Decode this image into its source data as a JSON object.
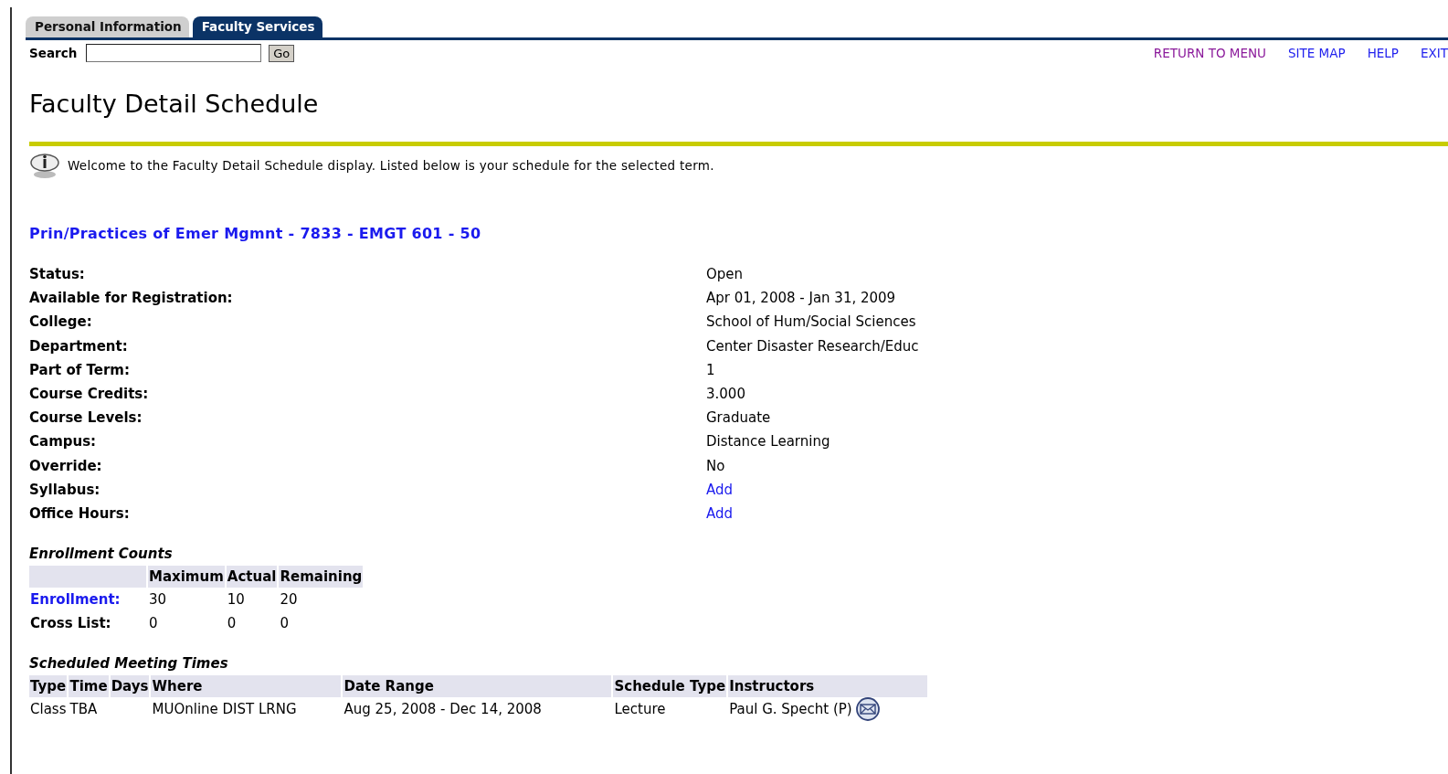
{
  "tabs": [
    {
      "label": "Personal Information",
      "selected": false
    },
    {
      "label": "Faculty Services",
      "selected": true
    }
  ],
  "search": {
    "label": "Search",
    "button": "Go"
  },
  "nav_links": [
    {
      "label": "RETURN TO MENU",
      "visited": true
    },
    {
      "label": "SITE MAP",
      "visited": false
    },
    {
      "label": "HELP",
      "visited": false
    },
    {
      "label": "EXIT",
      "visited": false
    }
  ],
  "page_title": "Faculty Detail Schedule",
  "info_message": "Welcome to the Faculty Detail Schedule display. Listed below is your schedule for the selected term.",
  "course_title": "Prin/Practices of Emer Mgmnt - 7833 - EMGT 601 - 50",
  "details": [
    {
      "label": "Status:",
      "value": "Open",
      "kind": "text"
    },
    {
      "label": "Available for Registration:",
      "value": "Apr 01, 2008 - Jan 31, 2009",
      "kind": "text"
    },
    {
      "label": "College:",
      "value": "School of Hum/Social Sciences",
      "kind": "text"
    },
    {
      "label": "Department:",
      "value": "Center Disaster Research/Educ",
      "kind": "text"
    },
    {
      "label": "Part of Term:",
      "value": "1",
      "kind": "text"
    },
    {
      "label": "Course Credits:",
      "value": "3.000",
      "kind": "text"
    },
    {
      "label": "Course Levels:",
      "value": "Graduate",
      "kind": "text"
    },
    {
      "label": "Campus:",
      "value": "Distance Learning",
      "kind": "text"
    },
    {
      "label": "Override:",
      "value": "No",
      "kind": "text"
    },
    {
      "label": "Syllabus:",
      "value": "Add",
      "kind": "link"
    },
    {
      "label": "Office Hours:",
      "value": "Add",
      "kind": "link"
    }
  ],
  "enrollment": {
    "title": "Enrollment Counts",
    "columns": [
      "Maximum",
      "Actual",
      "Remaining"
    ],
    "rows": [
      {
        "label": "Enrollment:",
        "kind": "link",
        "cells": [
          "30",
          "10",
          "20"
        ]
      },
      {
        "label": "Cross List:",
        "kind": "text",
        "cells": [
          "0",
          "0",
          "0"
        ]
      }
    ]
  },
  "meetings": {
    "title": "Scheduled Meeting Times",
    "columns": [
      "Type",
      "Time",
      "Days",
      "Where",
      "Date Range",
      "Schedule Type",
      "Instructors"
    ],
    "rows": [
      {
        "type": "Class",
        "time": "TBA",
        "where": "MUOnline DIST LRNG",
        "date_range": "Aug 25, 2008 - Dec 14, 2008",
        "schedule_type": "Lecture",
        "instructors": "Paul G. Specht (P)"
      }
    ]
  }
}
